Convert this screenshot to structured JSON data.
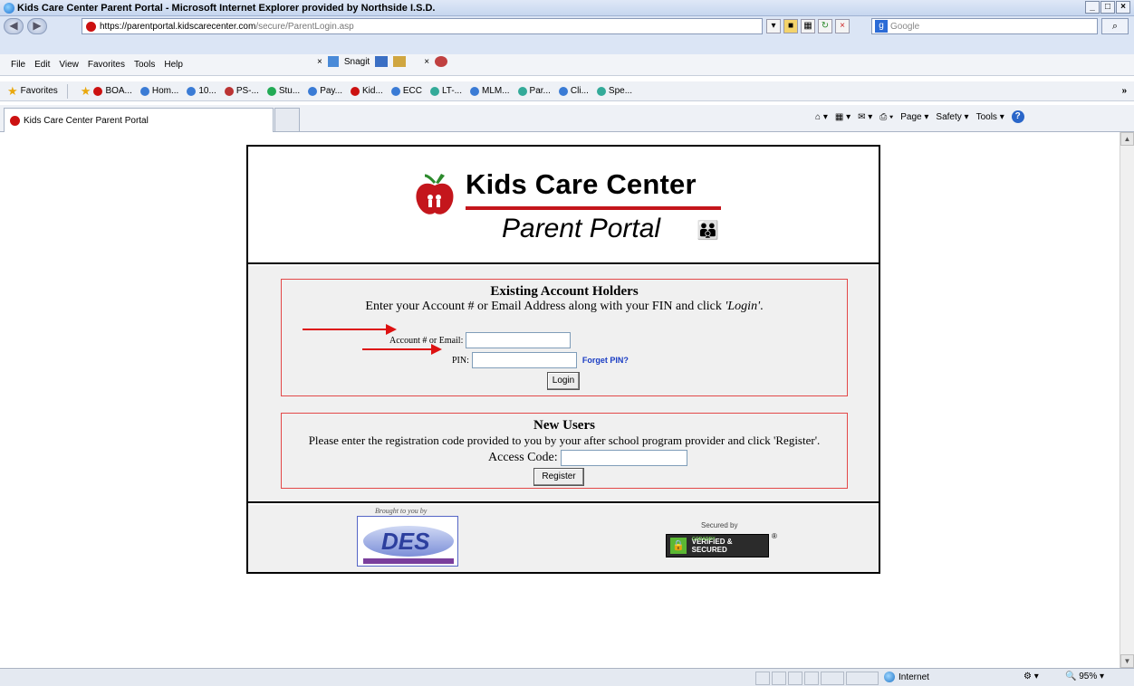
{
  "window": {
    "title": "Kids Care Center Parent Portal - Microsoft Internet Explorer provided by Northside I.S.D.",
    "min": "_",
    "max": "□",
    "close": "×"
  },
  "address": {
    "url_secure": "https://parentportal.kidscarecenter.com",
    "url_path": "/secure/ParentLogin.asp",
    "search_placeholder": "Google",
    "search_go": "⌕"
  },
  "menu": {
    "items": [
      "File",
      "Edit",
      "View",
      "Favorites",
      "Tools",
      "Help"
    ],
    "snagit": "Snagit"
  },
  "favorites": {
    "label": "Favorites",
    "links": [
      "BOA...",
      "Hom...",
      "10...",
      "PS-...",
      "Stu...",
      "Pay...",
      "Kid...",
      "ECC",
      "LT-...",
      "MLM...",
      "Par...",
      "Cli...",
      "Spe..."
    ]
  },
  "tab": {
    "label": "Kids Care Center Parent Portal"
  },
  "commands": {
    "page": "Page ▾",
    "safety": "Safety ▾",
    "tools": "Tools ▾",
    "help": "?"
  },
  "portal": {
    "brand": "Kids Care Center",
    "subtitle": "Parent Portal",
    "existing": {
      "heading": "Existing Account Holders",
      "instructions": "Enter your Account # or Email Address along with your FIN and click ",
      "instructions_login": "'Login'",
      "instructions_end": ".",
      "account_label": "Account # or Email:",
      "account_value": "",
      "pin_label": "PIN:",
      "pin_value": "",
      "forget_pin": "Forget PIN?",
      "login_button": "Login"
    },
    "new_users": {
      "heading": "New Users",
      "instructions": "Please enter the registration code provided to you by your after school program provider and click 'Register'.",
      "access_label": "Access Code:",
      "access_value": "",
      "register_button": "Register"
    },
    "footer": {
      "brought": "Brought to you by",
      "des_logo_text": "DES",
      "secured_by": "Secured by",
      "seal_brand": "GODADDY",
      "seal_text": "VERIFIED & SECURED",
      "seal_reg": "®"
    }
  },
  "status": {
    "zone": "Internet",
    "zoom": "95%"
  }
}
